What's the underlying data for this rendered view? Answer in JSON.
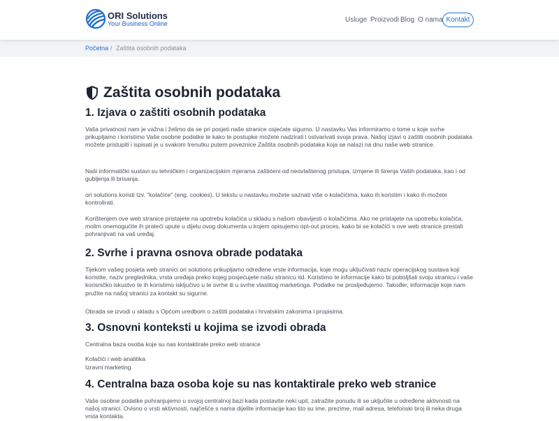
{
  "brand": {
    "name": "ORI Solutions",
    "tagline": "Your Business Online"
  },
  "nav": {
    "items": [
      "Usluge",
      "Proizvodi",
      "Blog",
      "O nama"
    ],
    "contact": "Kontakt"
  },
  "breadcrumb": {
    "home": "Početna",
    "separator": "/",
    "current": "Zaštita osobnih podataka"
  },
  "page": {
    "title": "Zaštita osobnih podataka",
    "sections": [
      {
        "heading": "1. Izjava o zaštiti osobnih podataka",
        "paragraphs": [
          "Vaša privatnost nam je važna i želimo da se pri posjeti naše stranice osjećate sigurno. U nastavku Vas informiramo o tome u koje svrhe prikupljamo i koristimo Vaše osobne podatke te kako te postupke možete nadzirati i ostvarivati svoja prava. Našoj izjavi o zaštiti osobnih podataka možete pristupiti i ispisati je u svakom trenutku putem poveznice Zaštita osobnih podataka koja se nalazi na dnu naše web stranice.",
          "Naši informatički sustavi su tehničkim i organizacijskim mjerama zaštićeni od neovlaštenog pristupa, izmjene ili širenja Vaših podataka, kao i od gubljenja ili brisanja.",
          "ori solutions koristi tzv. \"kolačiće\" (eng. cookies). U tekstu u nastavku možete saznati više o kolačićima, kako ih koristim i kako ih možete kontrolirati.",
          "Korištenjem ove web stranice pristajete na upotrebu kolačića u skladu s našom obavijesti o kolačićima. Ako ne pristajete na upotrebu kolačića, molim onemogućite ih prateći upute u dijelu ovog dokumenta u kojem opisujemo opt-out proces, kako bi se kolačići s ove web stranice prestali pohranjivati na vaš uređaj."
        ]
      },
      {
        "heading": "2. Svrhe i pravna osnova obrade podataka",
        "paragraphs": [
          "Tijekom vašeg posjeta web stranici ori solutions prikupljamo određene vrste informacija, koje mogu uključivati naziv operacijskog sustava koji koristite, naziv preglednika, vrsta uređaja preko kojeg posjećujete našu stranicu itd. Koristimo te informacije kako bi poboljšali svoju stranicu i vaše korisničko iskustvo te ih koristimo isključivo u te svrhe ili u svrhe vlastitog marketinga. Podatke ne prosljeđujemo. Također, informacije koje nam pružite na našoj stranici za kontakt su sigurne.",
          "Obrada se izvodi u skladu s Općom uredbom o zaštiti podataka i hrvatskim zakonima i propisima."
        ]
      },
      {
        "heading": "3. Osnovni konteksti u kojima se izvodi obrada",
        "paragraphs": [
          "Centralna baza osoba koje su nas kontaktirale preko web stranice",
          "Kolačići i web analitika",
          "Izravni marketing"
        ]
      },
      {
        "heading": "4. Centralna baza osoba koje su nas kontaktirale preko web stranice",
        "paragraphs": [
          "Vaše osobne podatke pohranjujemo u svojoj centralnoj bazi kada postavite neki upit, zatražite ponudu ili se uključite u određene aktivnosti na našoj stranici. Ovisno o vrsti aktivnosti, najčešće s nama dijelite informacije kao što su ime, prezime, mail adresa, telefonski broj ili neka druga vrsta kontakta."
        ]
      }
    ]
  },
  "colors": {
    "brand_blue": "#1f6fd1",
    "heading": "#1c2331",
    "text": "#4a505a",
    "crumb_bg": "#f1f3f6"
  },
  "icons": {
    "logo": "ori-logo-icon",
    "title": "shield-icon"
  }
}
